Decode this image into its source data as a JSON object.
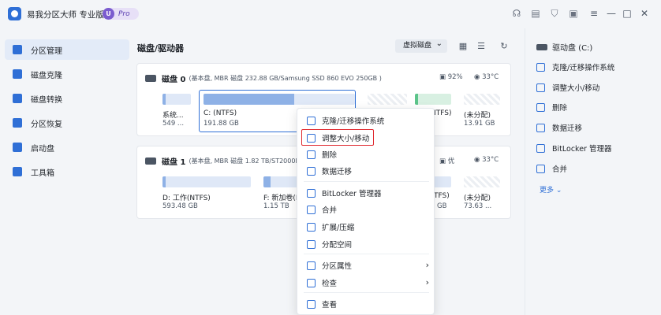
{
  "app": {
    "title": "易我分区大师 专业版",
    "badge_u": "U",
    "badge_text": "Pro",
    "brand_color": "#2f6fd6",
    "icons": [
      "headset-icon",
      "notes-icon",
      "shirt-icon",
      "video-icon",
      "menu-icon",
      "minimize-icon",
      "maximize-icon",
      "close-icon"
    ]
  },
  "sidebar": {
    "items": [
      {
        "label": "分区管理",
        "icon": "partition-icon",
        "active": true
      },
      {
        "label": "磁盘克隆",
        "icon": "clone-icon"
      },
      {
        "label": "磁盘转换",
        "icon": "convert-icon"
      },
      {
        "label": "分区恢复",
        "icon": "recovery-icon"
      },
      {
        "label": "启动盘",
        "icon": "usb-icon"
      },
      {
        "label": "工具箱",
        "icon": "toolbox-icon"
      }
    ]
  },
  "main": {
    "title": "磁盘/驱动器",
    "virtual_disk_label": "虚拟磁盘",
    "disks": [
      {
        "name": "磁盘 0",
        "info": "(基本盘, MBR 磁盘 232.88 GB/Samsung SSD 860 EVO 250GB )",
        "usage": "92%",
        "temp": "33°C",
        "partitions": [
          {
            "label": "系统...",
            "size": "549 ..."
          },
          {
            "label": "C: (NTFS)",
            "size": "191.88 GB"
          },
          {
            "label": "NTFS)",
            "size": ""
          },
          {
            "label": "(未分配)",
            "size": "13.91 GB"
          }
        ]
      },
      {
        "name": "磁盘 1",
        "info": "(基本盘, MBR 磁盘 1.82 TB/ST2000D",
        "status": "优",
        "temp": "33°C",
        "partitions": [
          {
            "label": "D: 工作(NTFS)",
            "size": "593.48 GB"
          },
          {
            "label": "F: 新加卷(I",
            "size": "1.15 TB"
          },
          {
            "label": "TFS)",
            "size": "GB"
          },
          {
            "label": "(未分配)",
            "size": "73.63 ..."
          }
        ]
      }
    ]
  },
  "context_menu": {
    "items": [
      {
        "label": "克隆/迁移操作系统",
        "icon": "clone-os-icon"
      },
      {
        "label": "调整大小/移动",
        "icon": "resize-icon",
        "highlighted": true
      },
      {
        "label": "删除",
        "icon": "trash-icon"
      },
      {
        "label": "数据迁移",
        "icon": "migrate-icon"
      },
      {
        "label": "BitLocker 管理器",
        "icon": "bitlocker-icon"
      },
      {
        "label": "合并",
        "icon": "merge-icon"
      },
      {
        "label": "扩展/压缩",
        "icon": "extend-icon"
      },
      {
        "label": "分配空间",
        "icon": "allocate-icon"
      },
      {
        "label": "分区属性",
        "icon": "properties-icon",
        "submenu": true
      },
      {
        "label": "检查",
        "icon": "check-icon",
        "submenu": true
      },
      {
        "label": "查看",
        "icon": "view-icon"
      }
    ]
  },
  "right_panel": {
    "drive": "驱动盘 (C:)",
    "actions": [
      {
        "label": "克隆/迁移操作系统",
        "icon": "clone-os-icon"
      },
      {
        "label": "调整大小/移动",
        "icon": "resize-icon"
      },
      {
        "label": "删除",
        "icon": "trash-icon"
      },
      {
        "label": "数据迁移",
        "icon": "migrate-icon"
      },
      {
        "label": "BitLocker 管理器",
        "icon": "bitlocker-icon"
      },
      {
        "label": "合并",
        "icon": "merge-icon"
      }
    ],
    "more": "更多 ⌄"
  }
}
